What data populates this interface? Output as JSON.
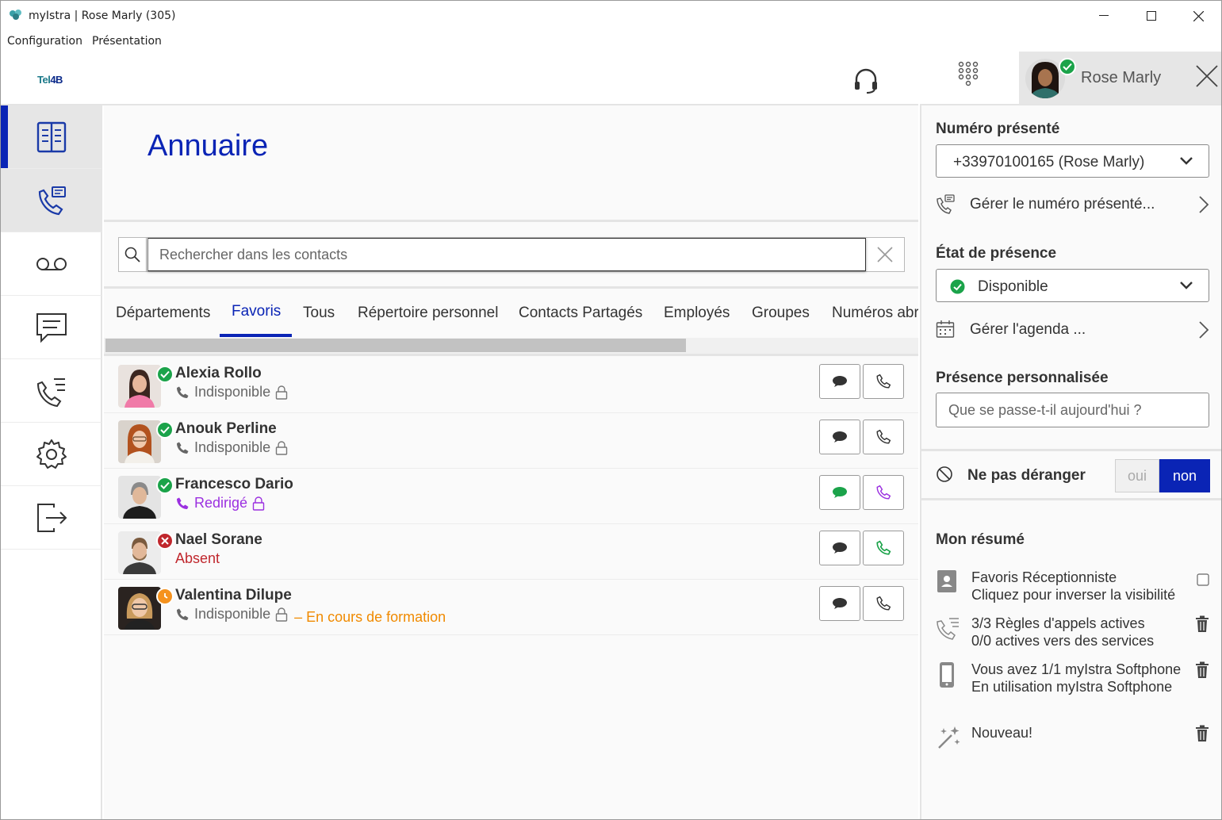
{
  "window": {
    "title": "myIstra | Rose Marly (305)"
  },
  "menu": {
    "items": [
      "Configuration",
      "Présentation"
    ]
  },
  "header": {
    "logo_a": "Tel",
    "logo_b": "4B"
  },
  "main": {
    "title": "Annuaire",
    "search": {
      "placeholder": "Rechercher dans les contacts",
      "value": ""
    },
    "tabs": [
      "Départements",
      "Favoris",
      "Tous",
      "Répertoire personnel",
      "Contacts Partagés",
      "Employés",
      "Groupes",
      "Numéros abr"
    ],
    "active_tab": "Favoris",
    "contacts": [
      {
        "name": "Alexia Rollo",
        "state": "Indisponible",
        "extra": "",
        "presence": "available"
      },
      {
        "name": "Anouk Perline",
        "state": "Indisponible",
        "extra": "",
        "presence": "available"
      },
      {
        "name": "Francesco Dario",
        "state": "Redirigé",
        "extra": "",
        "presence": "available"
      },
      {
        "name": "Nael Sorane",
        "state": "Absent",
        "extra": "",
        "presence": "absent"
      },
      {
        "name": "Valentina Dilupe",
        "state": "Indisponible",
        "extra": "– En cours de formation",
        "presence": "away"
      }
    ]
  },
  "right": {
    "user_name": "Rose Marly",
    "numero_presente_title": "Numéro présenté",
    "numero_presente_value": "+33970100165 (Rose Marly)",
    "gerer_numero": "Gérer le numéro présenté...",
    "etat_presence_title": "État de présence",
    "etat_presence_value": "Disponible",
    "gerer_agenda": "Gérer l'agenda ...",
    "presence_perso_title": "Présence personnalisée",
    "presence_perso_placeholder": "Que se passe-t-il aujourd'hui ?",
    "dnd_label": "Ne pas déranger",
    "dnd_oui": "oui",
    "dnd_non": "non",
    "resume_title": "Mon résumé",
    "resume": [
      {
        "line1": "Favoris Réceptionniste",
        "line2": "Cliquez pour inverser la visibilité"
      },
      {
        "line1": "3/3 Règles d'appels actives",
        "line2": "0/0 actives vers des services"
      },
      {
        "line1": "Vous avez 1/1 myIstra Softphone",
        "line2": "En utilisation myIstra Softphone"
      },
      {
        "line1": "Nouveau!",
        "line2": ""
      }
    ]
  },
  "colors": {
    "accent": "#0a24b5",
    "available": "#1ba34a",
    "absent": "#c0272d",
    "away": "#f5921e",
    "redirect": "#9b30e0"
  }
}
